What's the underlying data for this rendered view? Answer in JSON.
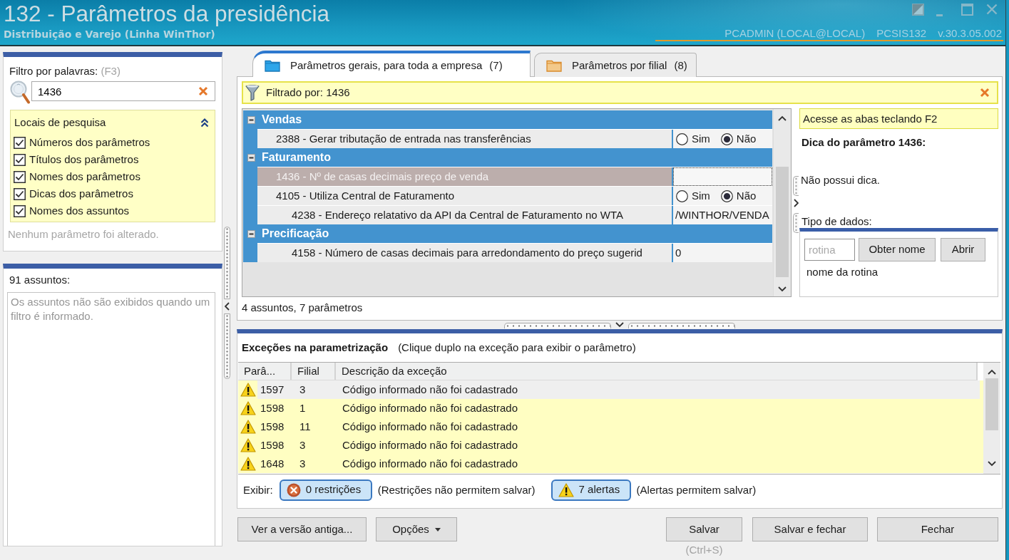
{
  "window": {
    "title": "132 - Parâmetros da presidência",
    "subtitle": "Distribuição e Varejo (Linha WinThor)",
    "user": "PCADMIN (LOCAL@LOCAL)",
    "program": "PCSIS132",
    "version": "v.30.3.05.002"
  },
  "word_filter": {
    "label": "Filtro por palavras:",
    "shortcut": "(F3)",
    "value": "1436",
    "search_locations": {
      "title": "Locais de pesquisa",
      "expanded": true,
      "options": [
        {
          "label": "Números dos parâmetros",
          "checked": true
        },
        {
          "label": "Títulos dos parâmetros",
          "checked": true
        },
        {
          "label": "Nomes dos parâmetros",
          "checked": true
        },
        {
          "label": "Dicas dos parâmetros",
          "checked": true
        },
        {
          "label": "Nomes dos assuntos",
          "checked": true
        }
      ]
    },
    "status": "Nenhum parâmetro foi alterado."
  },
  "subjects": {
    "count": "91 assuntos:",
    "message": "Os assuntos não são exibidos quando um filtro é informado."
  },
  "tabs": [
    {
      "label": "Parâmetros gerais, para toda a empresa",
      "count": "(7)",
      "kind": "company",
      "selected": true
    },
    {
      "label": "Parâmetros por filial",
      "count": "(8)",
      "kind": "branch",
      "selected": false
    }
  ],
  "filter_bar": {
    "text": "Filtrado por: 1436"
  },
  "parameter_groups": [
    {
      "name": "Vendas",
      "expanded": true,
      "parameters": [
        {
          "label": "2388 - Gerar tributação de entrada nas transferências",
          "dependent": false,
          "selected": false,
          "kind": "radio",
          "options": [
            {
              "label": "Sim",
              "selected": false
            },
            {
              "label": "Não",
              "selected": true
            }
          ]
        }
      ]
    },
    {
      "name": "Faturamento",
      "expanded": true,
      "parameters": [
        {
          "label": "1436 - Nº de casas decimais preço de venda",
          "dependent": false,
          "selected": true,
          "kind": "text"
        },
        {
          "label": "4105 - Utiliza Central de Faturamento",
          "dependent": false,
          "selected": false,
          "kind": "radio",
          "options": [
            {
              "label": "Sim",
              "selected": false
            },
            {
              "label": "Não",
              "selected": true
            }
          ]
        },
        {
          "label": "4238 - Endereço relatativo da API da Central de Faturamento no WTA",
          "dependent": true,
          "selected": false,
          "kind": "text",
          "value": "/WINTHOR/VENDA"
        }
      ]
    },
    {
      "name": "Precificação",
      "expanded": true,
      "parameters": [
        {
          "label": "4158 - Número de casas decimais para arredondamento do preço sugerid",
          "dependent": true,
          "selected": false,
          "kind": "text",
          "value": "0"
        }
      ]
    }
  ],
  "grid_summary": "4 assuntos, 7 parâmetros",
  "hint": {
    "tip": "Acesse as abas teclando F2",
    "title": "Dica do parâmetro 1436:",
    "text": "Não possui dica.",
    "data_type_label": "Tipo de dados:"
  },
  "routine_lookup": {
    "placeholder": "rotina",
    "buttons": [
      "Obter nome",
      "Abrir"
    ],
    "result": "nome da rotina"
  },
  "exceptions": {
    "title": "Exceções na parametrização",
    "note": "(Clique duplo na exceção para exibir o parâmetro)",
    "columns": [
      "Parâ...",
      "Filial",
      "Descrição da exceção"
    ],
    "rows": [
      {
        "kind": "alert",
        "parameter": "1597",
        "branch": "3",
        "description": "Código informado não foi cadastrado",
        "selected": true
      },
      {
        "kind": "alert",
        "parameter": "1598",
        "branch": "1",
        "description": "Código informado não foi cadastrado",
        "selected": false
      },
      {
        "kind": "alert",
        "parameter": "1598",
        "branch": "11",
        "description": "Código informado não foi cadastrado",
        "selected": false
      },
      {
        "kind": "alert",
        "parameter": "1598",
        "branch": "3",
        "description": "Código informado não foi cadastrado",
        "selected": false
      },
      {
        "kind": "alert",
        "parameter": "1648",
        "branch": "3",
        "description": "Código informado não foi cadastrado",
        "selected": false
      }
    ],
    "show_label": "Exibir:",
    "filters": [
      {
        "kind": "restriction",
        "label": "0 restrições",
        "note": "(Restrições não permitem salvar)",
        "on": true
      },
      {
        "kind": "alert",
        "label": "7 alertas",
        "note": "(Alertas permitem salvar)",
        "on": true
      }
    ]
  },
  "footer": {
    "left_buttons": [
      {
        "label": "Ver a versão antiga...",
        "dropdown": false
      },
      {
        "label": "Opções",
        "dropdown": true
      }
    ],
    "right_buttons": [
      {
        "label": "Salvar",
        "dropdown": false,
        "shortcut": "(Ctrl+S)"
      },
      {
        "label": "Salvar e fechar",
        "dropdown": false
      },
      {
        "label": "Fechar",
        "dropdown": false
      }
    ]
  }
}
